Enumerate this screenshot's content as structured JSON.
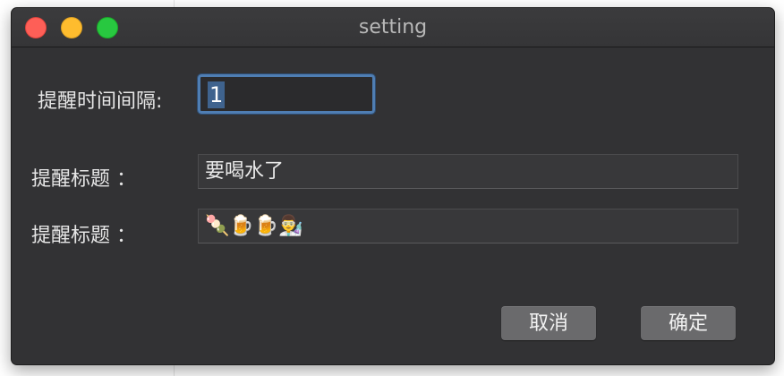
{
  "window": {
    "title": "setting"
  },
  "form": {
    "interval": {
      "label": "提醒时间间隔:",
      "value": "1"
    },
    "title_field": {
      "label": "提醒标题 ：",
      "value": "要喝水了"
    },
    "content_field": {
      "label": "提醒标题 ：",
      "value": "🍡🍺🍺👨‍🔬"
    }
  },
  "buttons": {
    "cancel_label": "取消",
    "confirm_label": "确定"
  },
  "icons": {
    "close": "close-icon",
    "minimize": "minimize-icon",
    "zoom": "zoom-icon"
  },
  "colors": {
    "window_bg": "#323234",
    "focus_ring": "#4f7eb3",
    "close": "#fe5f57",
    "minimize": "#febc2e",
    "zoom": "#28c840"
  }
}
